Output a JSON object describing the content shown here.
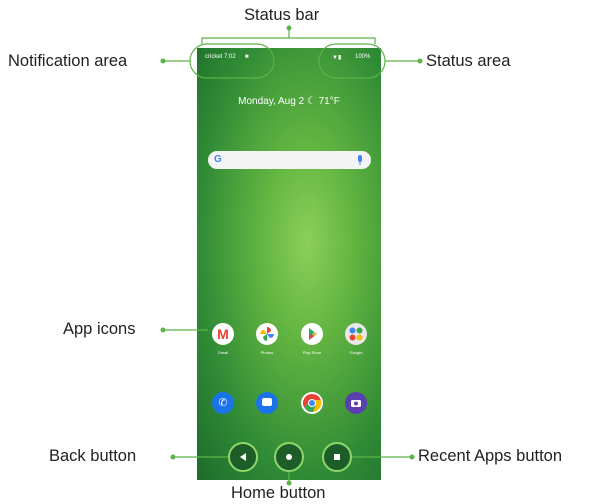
{
  "callouts": {
    "status_bar": "Status bar",
    "notification_area": "Notification area",
    "status_area": "Status area",
    "app_icons": "App icons",
    "back_button": "Back button",
    "home_button": "Home button",
    "recent_apps_button": "Recent Apps button"
  },
  "phone": {
    "carrier_time": "cricket 7:02",
    "battery": "100%",
    "date_weather": "Monday, Aug 2 ☾ 71°F",
    "search_logo": "G",
    "apps_row": [
      {
        "label": "Gmail",
        "icon": "gmail-icon"
      },
      {
        "label": "Photos",
        "icon": "photos-icon"
      },
      {
        "label": "Play Store",
        "icon": "play-store-icon"
      },
      {
        "label": "Google",
        "icon": "google-folder-icon"
      }
    ],
    "dock": [
      {
        "icon": "phone-icon"
      },
      {
        "icon": "messages-icon"
      },
      {
        "icon": "chrome-icon"
      },
      {
        "icon": "camera-icon"
      }
    ]
  },
  "colors": {
    "leader": "#5bb446",
    "wallpaper": "#4fa63c",
    "text": "#231f20"
  }
}
